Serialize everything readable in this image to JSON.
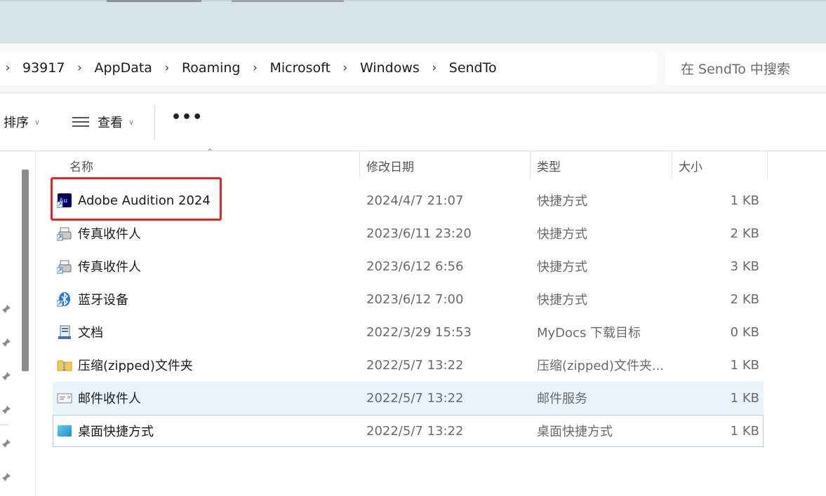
{
  "breadcrumb": [
    "93917",
    "AppData",
    "Roaming",
    "Microsoft",
    "Windows",
    "SendTo"
  ],
  "search": {
    "placeholder": "在 SendTo 中搜索"
  },
  "toolbar": {
    "sort_label": "排序",
    "view_label": "查看",
    "more_label": "•••"
  },
  "columns": {
    "name": "名称",
    "date": "修改日期",
    "type": "类型",
    "size": "大小"
  },
  "files": [
    {
      "name": "Adobe Audition 2024",
      "date": "2024/4/7 21:07",
      "type": "快捷方式",
      "size": "1 KB",
      "icon": "adobe-audition-icon"
    },
    {
      "name": "传真收件人",
      "date": "2023/6/11 23:20",
      "type": "快捷方式",
      "size": "2 KB",
      "icon": "fax-icon"
    },
    {
      "name": "传真收件人",
      "date": "2023/6/12 6:56",
      "type": "快捷方式",
      "size": "3 KB",
      "icon": "fax-icon"
    },
    {
      "name": "蓝牙设备",
      "date": "2023/6/12 7:00",
      "type": "快捷方式",
      "size": "2 KB",
      "icon": "bluetooth-icon"
    },
    {
      "name": "文档",
      "date": "2022/3/29 15:53",
      "type": "MyDocs 下载目标",
      "size": "0 KB",
      "icon": "documents-icon"
    },
    {
      "name": "压缩(zipped)文件夹",
      "date": "2022/5/7 13:22",
      "type": "压缩(zipped)文件夹...",
      "size": "1 KB",
      "icon": "zip-folder-icon"
    },
    {
      "name": "邮件收件人",
      "date": "2022/5/7 13:22",
      "type": "邮件服务",
      "size": "1 KB",
      "icon": "mail-icon"
    },
    {
      "name": "桌面快捷方式",
      "date": "2022/5/7 13:22",
      "type": "桌面快捷方式",
      "size": "1 KB",
      "icon": "desktop-icon"
    }
  ],
  "colors": {
    "highlight": "#e8231f",
    "hover_row": "#e8f3fb",
    "selected_border": "#a7cbe3",
    "title_strip": "#d6e4ea"
  }
}
